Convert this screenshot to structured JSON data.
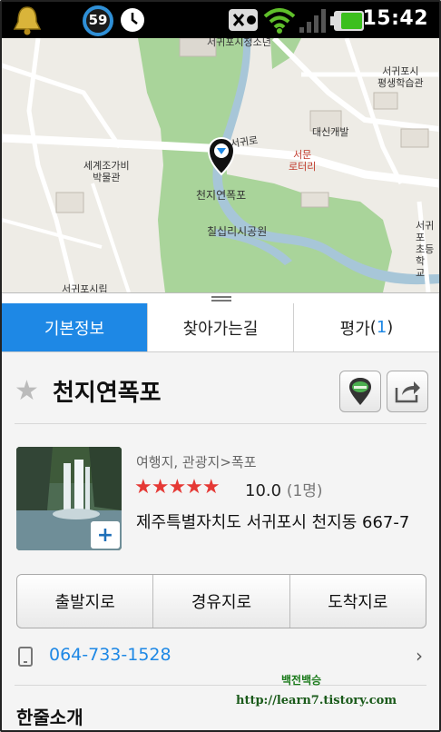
{
  "status_bar": {
    "badge_number": "59",
    "clock": "15:42",
    "icons": [
      "bell-icon",
      "badge-59",
      "alarm-clock-icon",
      "usb-debug-icon",
      "wifi-icon",
      "signal-icon",
      "battery-icon"
    ]
  },
  "map": {
    "labels": {
      "top_cut": "서귀포시청소년",
      "seoguipo_learning": [
        "서귀포시",
        "평생학습관"
      ],
      "daesin": "대신개발",
      "seogwi_road": "서귀로",
      "seomun_rotary": [
        "서문",
        "로터리"
      ],
      "museum": [
        "세계조가비",
        "박물관"
      ],
      "falls": "천지연폭포",
      "park": "칠십리시공원",
      "right_edge": [
        "서귀포",
        "초등학",
        "교"
      ],
      "bottom_cut": "서귀포시립"
    },
    "colors": {
      "park": "#a9d49a",
      "water": "#a7c6d8",
      "land": "#eeece6",
      "road": "#ffffff"
    }
  },
  "tabs": [
    {
      "label": "기본정보",
      "active": true
    },
    {
      "label": "찾아가는길",
      "active": false
    },
    {
      "label": "평가",
      "count": "1",
      "active": false
    }
  ],
  "place": {
    "name": "천지연폭포",
    "category": "여행지, 관광지>폭포",
    "rating_stars": "★★★★★",
    "rating": "10.0",
    "review_count": "(1명)",
    "address": "제주특별자치도 서귀포시 천지동 667-7",
    "photo_more": "+"
  },
  "routes": [
    "출발지로",
    "경유지로",
    "도착지로"
  ],
  "phone": "064-733-1528",
  "chevron": "›",
  "section_title": "한줄소개",
  "watermark": {
    "name": "백전백승",
    "url": "http://learn7.tistory.com"
  },
  "colors": {
    "accent": "#1e88e5",
    "rating": "#e53935"
  }
}
